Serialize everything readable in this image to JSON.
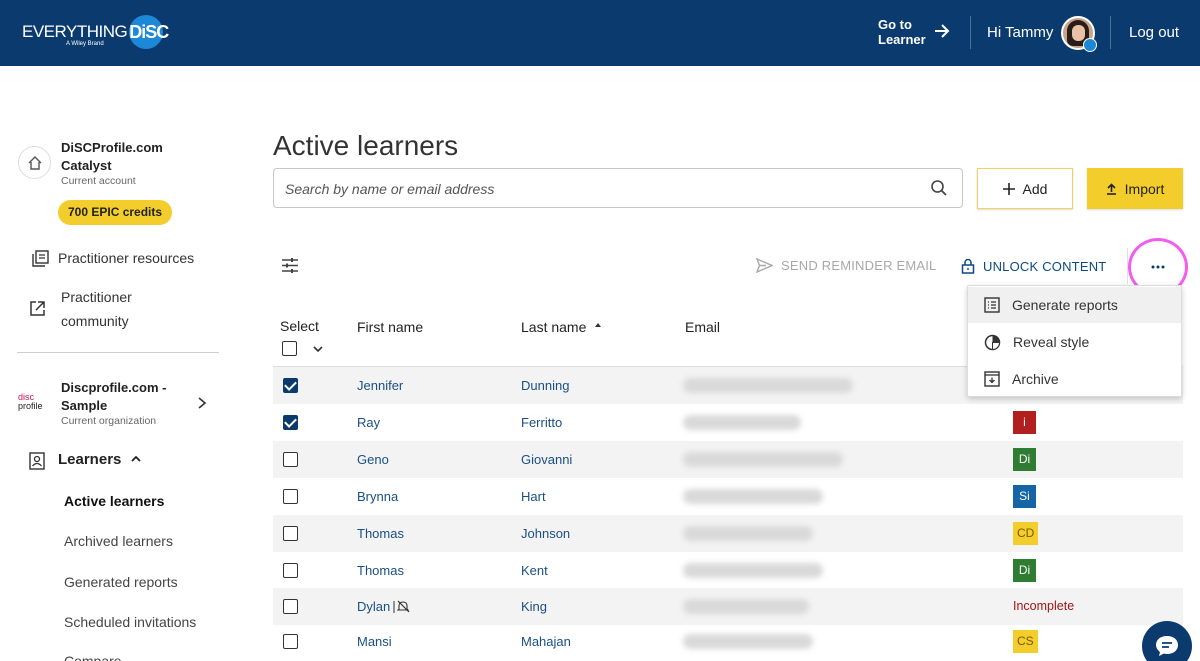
{
  "header": {
    "logo_text": "EVERYTHING",
    "logo_badge": "DiSC",
    "logo_sub": "A Wiley Brand",
    "goto_line1": "Go to",
    "goto_line2": "Learner",
    "greeting": "Hi Tammy",
    "logout": "Log out"
  },
  "sidebar": {
    "account_name": "DiSCProfile.com Catalyst",
    "account_sub": "Current account",
    "credits": "700 EPIC credits",
    "links": [
      {
        "label": "Practitioner resources",
        "icon": "resources-icon"
      },
      {
        "label": "Practitioner community",
        "icon": "external-link-icon"
      }
    ],
    "org_logo_top": "disc",
    "org_logo_bottom": "profile",
    "org_name": "Discprofile.com - Sample",
    "org_sub": "Current organization",
    "learners_label": "Learners",
    "sub_items": [
      {
        "label": "Active learners",
        "active": true
      },
      {
        "label": "Archived learners",
        "active": false
      },
      {
        "label": "Generated reports",
        "active": false
      },
      {
        "label": "Scheduled invitations",
        "active": false
      },
      {
        "label": "Compare",
        "active": false
      }
    ]
  },
  "main": {
    "title": "Active learners",
    "search_placeholder": "Search by name or email address",
    "add_label": "Add",
    "import_label": "Import",
    "send_reminder_label": "SEND REMINDER EMAIL",
    "unlock_label": "UNLOCK CONTENT",
    "columns": {
      "select": "Select",
      "first_name": "First name",
      "last_name": "Last name",
      "email": "Email"
    }
  },
  "rows": [
    {
      "first": "Jennifer",
      "last": "Dunning",
      "checked": true,
      "style": "",
      "style_color": "#1565a6"
    },
    {
      "first": "Ray",
      "last": "Ferritto",
      "checked": true,
      "style": "i",
      "style_color": "#b11f1f"
    },
    {
      "first": "Geno",
      "last": "Giovanni",
      "checked": false,
      "style": "Di",
      "style_color": "#2e7d32"
    },
    {
      "first": "Brynna",
      "last": "Hart",
      "checked": false,
      "style": "Si",
      "style_color": "#1565a6"
    },
    {
      "first": "Thomas",
      "last": "Johnson",
      "checked": false,
      "style": "CD",
      "style_color": "#f3cd2b"
    },
    {
      "first": "Thomas",
      "last": "Kent",
      "checked": false,
      "style": "Di",
      "style_color": "#2e7d32"
    },
    {
      "first": "Dylan",
      "last": "King",
      "checked": false,
      "style": "Incomplete",
      "style_color": "#a31515"
    },
    {
      "first": "Mansi",
      "last": "Mahajan",
      "checked": false,
      "style": "CS",
      "style_color": "#f3cd2b"
    }
  ],
  "menu": {
    "items": [
      {
        "label": "Generate reports",
        "icon": "report-icon"
      },
      {
        "label": "Reveal style",
        "icon": "reveal-style-icon"
      },
      {
        "label": "Archive",
        "icon": "archive-icon"
      }
    ]
  },
  "colors": {
    "brand_navy": "#0b3b6e",
    "accent_yellow": "#f3cd2b",
    "link_blue": "#1a4f85",
    "highlight_magenta": "#f25cf0"
  }
}
